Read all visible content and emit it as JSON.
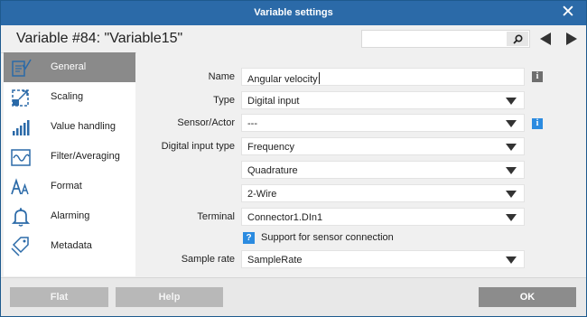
{
  "window": {
    "title": "Variable settings"
  },
  "header": {
    "title": "Variable #84: \"Variable15\"",
    "search_value": ""
  },
  "sidebar": {
    "items": [
      {
        "label": "General",
        "icon": "general-icon",
        "active": true
      },
      {
        "label": "Scaling",
        "icon": "scaling-icon",
        "active": false
      },
      {
        "label": "Value handling",
        "icon": "value-handling-icon",
        "active": false
      },
      {
        "label": "Filter/Averaging",
        "icon": "filter-icon",
        "active": false
      },
      {
        "label": "Format",
        "icon": "format-icon",
        "active": false
      },
      {
        "label": "Alarming",
        "icon": "bell-icon",
        "active": false
      },
      {
        "label": "Metadata",
        "icon": "tags-icon",
        "active": false
      }
    ]
  },
  "form": {
    "name": {
      "label": "Name",
      "value": "Angular velocity"
    },
    "type": {
      "label": "Type",
      "value": "Digital input"
    },
    "sensor": {
      "label": "Sensor/Actor",
      "value": "---"
    },
    "digital_input_type": {
      "label": "Digital input type",
      "value": "Frequency"
    },
    "mode": {
      "value": "Quadrature"
    },
    "wiring": {
      "value": "2-Wire"
    },
    "terminal": {
      "label": "Terminal",
      "value": "Connector1.DIn1"
    },
    "support": {
      "label": "Support for sensor connection",
      "mark": "?"
    },
    "sample_rate": {
      "label": "Sample rate",
      "value": "SampleRate"
    },
    "info_glyph": "i"
  },
  "footer": {
    "flat": "Flat",
    "help": "Help",
    "ok": "OK"
  },
  "colors": {
    "titlebar": "#2b6aa8",
    "accent_blue": "#2b8be0",
    "active_item": "#8a8a8a"
  }
}
